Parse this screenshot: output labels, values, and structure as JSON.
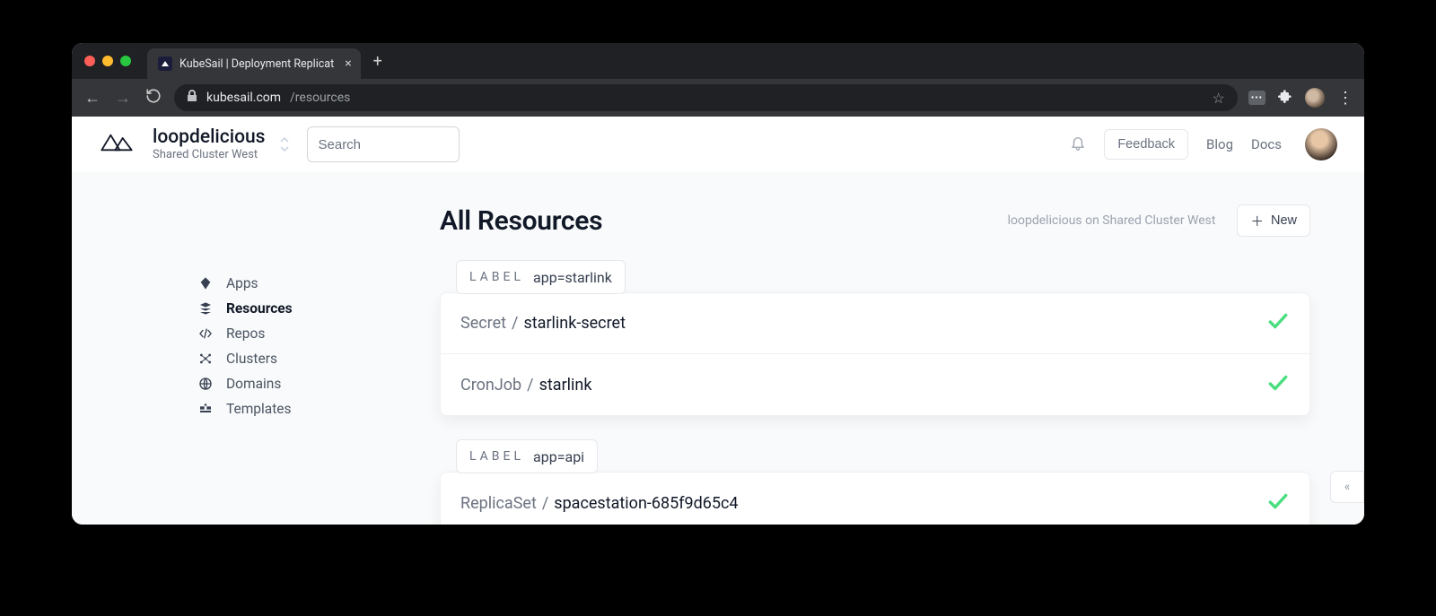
{
  "browser": {
    "tab_title": "KubeSail | Deployment Replicat",
    "url_domain": "kubesail.com",
    "url_path": "/resources"
  },
  "header": {
    "context_name": "loopdelicious",
    "context_sub": "Shared Cluster West",
    "search_placeholder": "Search",
    "feedback": "Feedback",
    "blog": "Blog",
    "docs": "Docs"
  },
  "sidebar": {
    "items": [
      {
        "id": "apps",
        "label": "Apps"
      },
      {
        "id": "resources",
        "label": "Resources"
      },
      {
        "id": "repos",
        "label": "Repos"
      },
      {
        "id": "clusters",
        "label": "Clusters"
      },
      {
        "id": "domains",
        "label": "Domains"
      },
      {
        "id": "templates",
        "label": "Templates"
      }
    ],
    "active": "resources"
  },
  "page": {
    "title": "All Resources",
    "crumb": "loopdelicious on Shared Cluster West",
    "new_label": "New",
    "label_word": "LABEL",
    "groups": [
      {
        "label": "app=starlink",
        "rows": [
          {
            "kind": "Secret",
            "name": "starlink-secret",
            "ok": true
          },
          {
            "kind": "CronJob",
            "name": "starlink",
            "ok": true
          }
        ]
      },
      {
        "label": "app=api",
        "rows": [
          {
            "kind": "ReplicaSet",
            "name": "spacestation-685f9d65c4",
            "ok": true
          }
        ]
      }
    ]
  }
}
